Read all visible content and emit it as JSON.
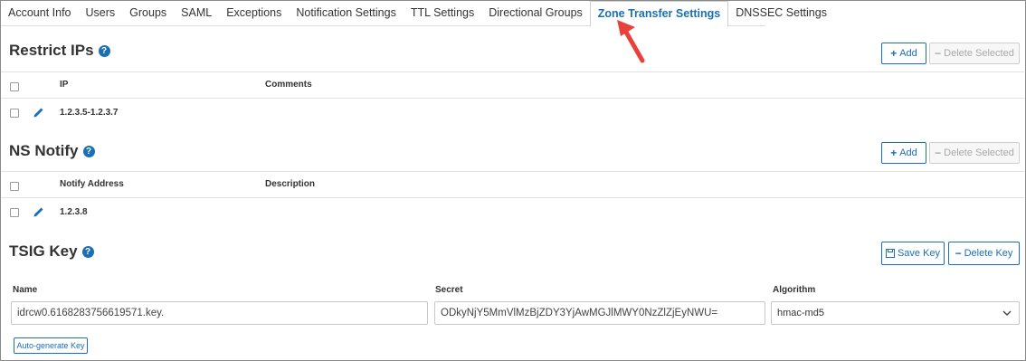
{
  "tabs": [
    {
      "label": "Account Info",
      "active": false
    },
    {
      "label": "Users",
      "active": false
    },
    {
      "label": "Groups",
      "active": false
    },
    {
      "label": "SAML",
      "active": false
    },
    {
      "label": "Exceptions",
      "active": false
    },
    {
      "label": "Notification Settings",
      "active": false
    },
    {
      "label": "TTL Settings",
      "active": false
    },
    {
      "label": "Directional Groups",
      "active": false
    },
    {
      "label": "Zone Transfer Settings",
      "active": true
    },
    {
      "label": "DNSSEC Settings",
      "active": false
    }
  ],
  "colors": {
    "accent": "#1a6fb5",
    "arrow": "#e8413c"
  },
  "restrict_ips": {
    "title": "Restrict IPs",
    "add_label": "Add",
    "delete_label": "Delete Selected",
    "columns": [
      "IP",
      "Comments"
    ],
    "rows": [
      {
        "ip": "1.2.3.5-1.2.3.7",
        "comment": ""
      }
    ]
  },
  "ns_notify": {
    "title": "NS Notify",
    "add_label": "Add",
    "delete_label": "Delete Selected",
    "columns": [
      "Notify Address",
      "Description"
    ],
    "rows": [
      {
        "address": "1.2.3.8",
        "description": ""
      }
    ]
  },
  "tsig": {
    "title": "TSIG Key",
    "save_label": "Save Key",
    "delete_label": "Delete Key",
    "name_label": "Name",
    "name_value": "idrcw0.6168283756619571.key.",
    "secret_label": "Secret",
    "secret_value": "ODkyNjY5MmVlMzBjZDY3YjAwMGJlMWY0NzZlZjEyNWU=",
    "algorithm_label": "Algorithm",
    "algorithm_value": "hmac-md5",
    "autogen_label": "Auto-generate Key"
  }
}
